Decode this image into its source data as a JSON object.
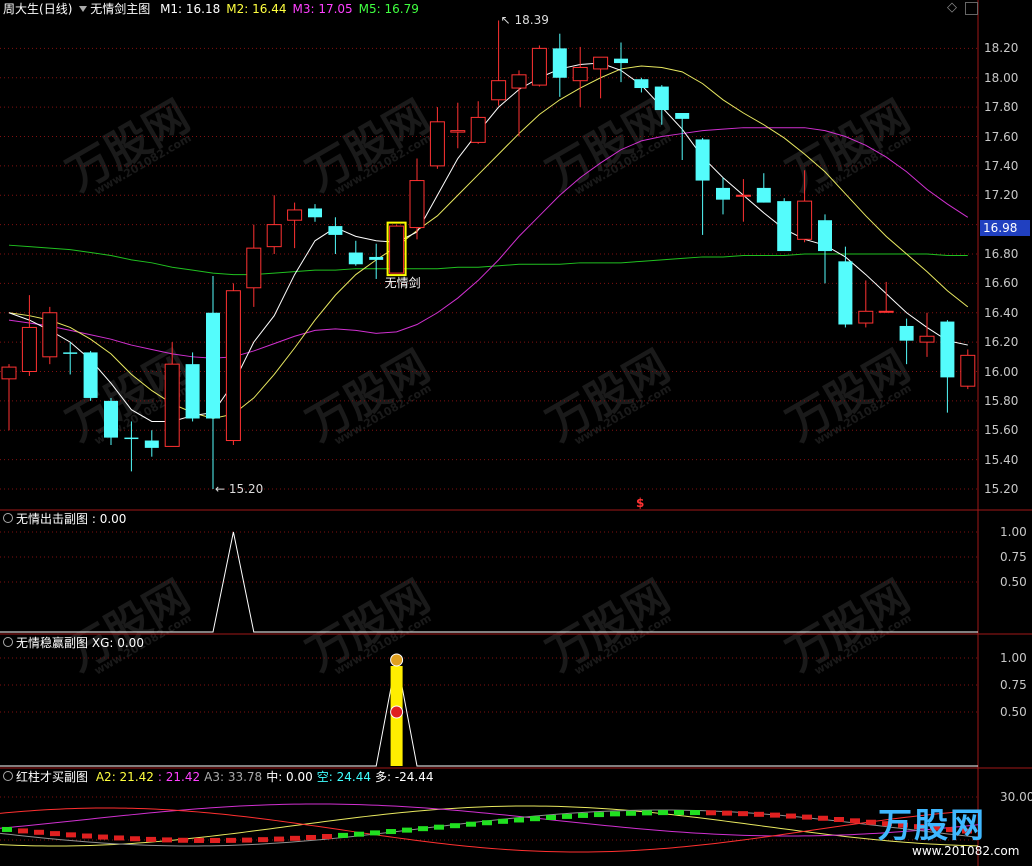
{
  "header": {
    "stock": "周大生",
    "period": "(日线)",
    "indicator": "无情剑主图",
    "ma": [
      {
        "label": "M1: ",
        "value": "16.18",
        "color": "#ffffff"
      },
      {
        "label": "M2: ",
        "value": "16.44",
        "color": "#ffff40"
      },
      {
        "label": "M3: ",
        "value": "17.05",
        "color": "#ff40ff"
      },
      {
        "label": "M5: ",
        "value": "16.79",
        "color": "#40ff40"
      }
    ]
  },
  "main": {
    "y_ticks": [
      "18.20",
      "18.00",
      "17.80",
      "17.60",
      "17.40",
      "17.20",
      "17.00",
      "16.80",
      "16.60",
      "16.40",
      "16.20",
      "16.00",
      "15.80",
      "15.60",
      "15.40",
      "15.20"
    ],
    "y_top": "18.40",
    "current_price": "16.98",
    "high_label": "18.39",
    "low_label": "15.20",
    "signal_label": "无情剑",
    "s_marker": "$"
  },
  "chart_data": {
    "type": "candlestick",
    "ylim": [
      15.12,
      18.5
    ],
    "candles": [
      {
        "o": 15.95,
        "h": 16.05,
        "l": 15.6,
        "c": 16.03
      },
      {
        "o": 16.0,
        "h": 16.52,
        "l": 15.97,
        "c": 16.3
      },
      {
        "o": 16.1,
        "h": 16.44,
        "l": 16.05,
        "c": 16.4
      },
      {
        "o": 16.13,
        "h": 16.2,
        "l": 15.98,
        "c": 16.12
      },
      {
        "o": 16.13,
        "h": 16.14,
        "l": 15.8,
        "c": 15.82
      },
      {
        "o": 15.8,
        "h": 15.82,
        "l": 15.5,
        "c": 15.55
      },
      {
        "o": 15.55,
        "h": 15.66,
        "l": 15.32,
        "c": 15.54
      },
      {
        "o": 15.53,
        "h": 15.6,
        "l": 15.42,
        "c": 15.48
      },
      {
        "o": 15.49,
        "h": 16.2,
        "l": 15.49,
        "c": 16.05
      },
      {
        "o": 16.05,
        "h": 16.13,
        "l": 15.66,
        "c": 15.68
      },
      {
        "o": 16.4,
        "h": 16.65,
        "l": 15.2,
        "c": 15.68
      },
      {
        "o": 15.53,
        "h": 16.6,
        "l": 15.5,
        "c": 16.55
      },
      {
        "o": 16.57,
        "h": 17.0,
        "l": 16.44,
        "c": 16.84
      },
      {
        "o": 16.85,
        "h": 17.2,
        "l": 16.8,
        "c": 17.0
      },
      {
        "o": 17.03,
        "h": 17.15,
        "l": 16.84,
        "c": 17.1
      },
      {
        "o": 17.11,
        "h": 17.14,
        "l": 17.02,
        "c": 17.05
      },
      {
        "o": 16.99,
        "h": 17.05,
        "l": 16.8,
        "c": 16.93
      },
      {
        "o": 16.81,
        "h": 16.89,
        "l": 16.72,
        "c": 16.73
      },
      {
        "o": 16.78,
        "h": 16.87,
        "l": 16.63,
        "c": 16.76
      },
      {
        "o": 16.67,
        "h": 17.0,
        "l": 16.67,
        "c": 16.99
      },
      {
        "o": 16.98,
        "h": 17.45,
        "l": 16.9,
        "c": 17.3
      },
      {
        "o": 17.4,
        "h": 17.8,
        "l": 17.38,
        "c": 17.7
      },
      {
        "o": 17.63,
        "h": 17.83,
        "l": 17.52,
        "c": 17.64
      },
      {
        "o": 17.56,
        "h": 17.84,
        "l": 17.55,
        "c": 17.73
      },
      {
        "o": 17.85,
        "h": 18.39,
        "l": 17.81,
        "c": 17.98
      },
      {
        "o": 17.93,
        "h": 18.05,
        "l": 17.6,
        "c": 18.02
      },
      {
        "o": 17.95,
        "h": 18.22,
        "l": 17.94,
        "c": 18.2
      },
      {
        "o": 18.2,
        "h": 18.3,
        "l": 17.87,
        "c": 18.0
      },
      {
        "o": 17.98,
        "h": 18.21,
        "l": 17.8,
        "c": 18.07
      },
      {
        "o": 18.06,
        "h": 18.14,
        "l": 17.86,
        "c": 18.14
      },
      {
        "o": 18.13,
        "h": 18.24,
        "l": 17.97,
        "c": 18.1
      },
      {
        "o": 17.99,
        "h": 18.0,
        "l": 17.9,
        "c": 17.93
      },
      {
        "o": 17.94,
        "h": 17.95,
        "l": 17.68,
        "c": 17.78
      },
      {
        "o": 17.76,
        "h": 17.73,
        "l": 17.44,
        "c": 17.72
      },
      {
        "o": 17.58,
        "h": 17.59,
        "l": 16.93,
        "c": 17.3
      },
      {
        "o": 17.25,
        "h": 17.32,
        "l": 17.07,
        "c": 17.17
      },
      {
        "o": 17.2,
        "h": 17.31,
        "l": 17.02,
        "c": 17.2
      },
      {
        "o": 17.25,
        "h": 17.35,
        "l": 17.15,
        "c": 17.15
      },
      {
        "o": 17.16,
        "h": 17.18,
        "l": 16.88,
        "c": 16.82
      },
      {
        "o": 16.9,
        "h": 17.37,
        "l": 16.88,
        "c": 17.16
      },
      {
        "o": 17.03,
        "h": 17.07,
        "l": 16.6,
        "c": 16.82
      },
      {
        "o": 16.75,
        "h": 16.85,
        "l": 16.3,
        "c": 16.32
      },
      {
        "o": 16.33,
        "h": 16.62,
        "l": 16.3,
        "c": 16.41
      },
      {
        "o": 16.41,
        "h": 16.61,
        "l": 16.4,
        "c": 16.41
      },
      {
        "o": 16.31,
        "h": 16.36,
        "l": 16.05,
        "c": 16.21
      },
      {
        "o": 16.2,
        "h": 16.4,
        "l": 16.1,
        "c": 16.24
      },
      {
        "o": 16.34,
        "h": 16.35,
        "l": 15.72,
        "c": 15.96
      },
      {
        "o": 15.9,
        "h": 16.15,
        "l": 15.88,
        "c": 16.11
      }
    ],
    "ma_m1": [
      16.4,
      16.35,
      16.28,
      16.2,
      16.08,
      15.92,
      15.74,
      15.66,
      15.66,
      15.7,
      15.72,
      15.92,
      16.2,
      16.38,
      16.66,
      16.89,
      16.98,
      16.92,
      16.89,
      16.88,
      16.95,
      17.2,
      17.45,
      17.63,
      17.8,
      17.92,
      18.0,
      18.06,
      18.09,
      18.1,
      18.05,
      17.95,
      17.8,
      17.65,
      17.46,
      17.32,
      17.2,
      17.08,
      16.97,
      16.9,
      16.86,
      16.78,
      16.66,
      16.53,
      16.4,
      16.3,
      16.21,
      16.18
    ],
    "ma_m2": [
      16.4,
      16.38,
      16.35,
      16.3,
      16.22,
      16.12,
      15.98,
      15.87,
      15.78,
      15.72,
      15.68,
      15.71,
      15.82,
      15.98,
      16.16,
      16.35,
      16.52,
      16.66,
      16.76,
      16.85,
      16.96,
      17.06,
      17.2,
      17.34,
      17.48,
      17.62,
      17.75,
      17.85,
      17.93,
      18.0,
      18.06,
      18.08,
      18.07,
      18.04,
      17.96,
      17.85,
      17.76,
      17.68,
      17.59,
      17.48,
      17.36,
      17.21,
      17.06,
      16.92,
      16.8,
      16.68,
      16.55,
      16.44
    ],
    "ma_m3": [
      16.35,
      16.33,
      16.31,
      16.28,
      16.25,
      16.22,
      16.18,
      16.15,
      16.12,
      16.1,
      16.09,
      16.1,
      16.14,
      16.19,
      16.24,
      16.28,
      16.29,
      16.28,
      16.26,
      16.27,
      16.32,
      16.4,
      16.5,
      16.62,
      16.76,
      16.92,
      17.06,
      17.2,
      17.32,
      17.42,
      17.51,
      17.57,
      17.6,
      17.62,
      17.64,
      17.65,
      17.66,
      17.66,
      17.66,
      17.66,
      17.64,
      17.6,
      17.54,
      17.46,
      17.36,
      17.24,
      17.14,
      17.05
    ],
    "ma_m5": [
      16.86,
      16.85,
      16.84,
      16.83,
      16.81,
      16.79,
      16.76,
      16.74,
      16.71,
      16.69,
      16.67,
      16.66,
      16.66,
      16.67,
      16.68,
      16.69,
      16.69,
      16.7,
      16.7,
      16.7,
      16.7,
      16.7,
      16.71,
      16.71,
      16.72,
      16.73,
      16.73,
      16.73,
      16.74,
      16.74,
      16.74,
      16.75,
      16.76,
      16.77,
      16.78,
      16.78,
      16.79,
      16.79,
      16.79,
      16.8,
      16.8,
      16.8,
      16.8,
      16.8,
      16.8,
      16.8,
      16.79,
      16.79
    ],
    "signal_index": 19
  },
  "sub1": {
    "title": "无情出击副图",
    "value_text": " : 0.00",
    "y_ticks": [
      "1.00",
      "0.75",
      "0.50"
    ],
    "peak_index": 11
  },
  "sub2": {
    "title": "无情稳赢副图",
    "value_label": "XG: ",
    "value": "0.00",
    "y_ticks": [
      "1.00",
      "0.75",
      "0.50"
    ],
    "peak_index": 19
  },
  "sub3": {
    "title": "红柱才买副图",
    "items": [
      {
        "label": "A2: ",
        "value": "21.42",
        "color": "#ffff40"
      },
      {
        "label": ": ",
        "value": "21.42",
        "color": "#ff40ff"
      },
      {
        "label": "A3: ",
        "value": "33.78",
        "color": "#aaaaaa"
      },
      {
        "label": "中: ",
        "value": "0.00",
        "color": "#ffffff"
      },
      {
        "label": "空: ",
        "value": "24.44",
        "color": "#40ffff"
      },
      {
        "label": "多: ",
        "value": "-24.44",
        "color": "#ffffff"
      }
    ],
    "y_ticks": [
      "30.00"
    ]
  },
  "watermark": {
    "brand": "万股网",
    "site": "www.201082.com",
    "logo_text": "万股网",
    "logo_url": "www.201082.com"
  },
  "colors": {
    "up": "#ff3232",
    "down": "#54fcfc",
    "grid": "#801010"
  }
}
